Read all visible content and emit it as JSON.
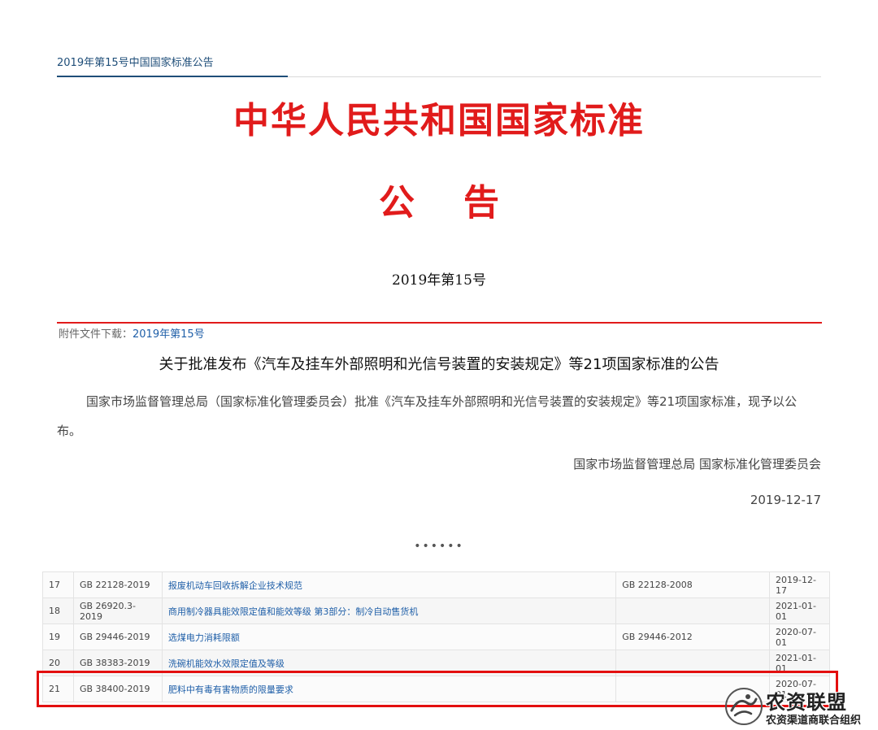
{
  "breadcrumb": "2019年第15号中国国家标准公告",
  "header": {
    "title": "中华人民共和国国家标准",
    "notice": "公告",
    "issue_no": "2019年第15号"
  },
  "attachment": {
    "label": "附件文件下载：",
    "link": "2019年第15号"
  },
  "announcement": {
    "headline": "关于批准发布《汽车及挂车外部照明和光信号装置的安装规定》等21项国家标准的公告",
    "body": "国家市场监督管理总局（国家标准化管理委员会）批准《汽车及挂车外部照明和光信号装置的安装规定》等21项国家标准，现予以公布。",
    "signature": "国家市场监督管理总局 国家标准化管理委员会",
    "date": "2019-12-17",
    "ellipsis": "••••••"
  },
  "standards": [
    {
      "no": "17",
      "code": "GB 22128-2019",
      "name": "报废机动车回收拆解企业技术规范",
      "replaces": "GB 22128-2008",
      "date": "2019-12-17"
    },
    {
      "no": "18",
      "code": "GB 26920.3-2019",
      "name": "商用制冷器具能效限定值和能效等级 第3部分：制冷自动售货机",
      "replaces": "",
      "date": "2021-01-01"
    },
    {
      "no": "19",
      "code": "GB 29446-2019",
      "name": "选煤电力消耗限额",
      "replaces": "GB 29446-2012",
      "date": "2020-07-01"
    },
    {
      "no": "20",
      "code": "GB 38383-2019",
      "name": "洗碗机能效水效限定值及等级",
      "replaces": "",
      "date": "2021-01-01"
    },
    {
      "no": "21",
      "code": "GB 38400-2019",
      "name": "肥料中有毒有害物质的限量要求",
      "replaces": "",
      "date": "2020-07-01"
    }
  ],
  "watermark": {
    "name": "农资联盟",
    "sub": "农资渠道商联合组织"
  },
  "colors": {
    "title_red": "#e11b1b",
    "link_blue": "#1f5fa8",
    "highlight_red": "#e30f0f"
  }
}
